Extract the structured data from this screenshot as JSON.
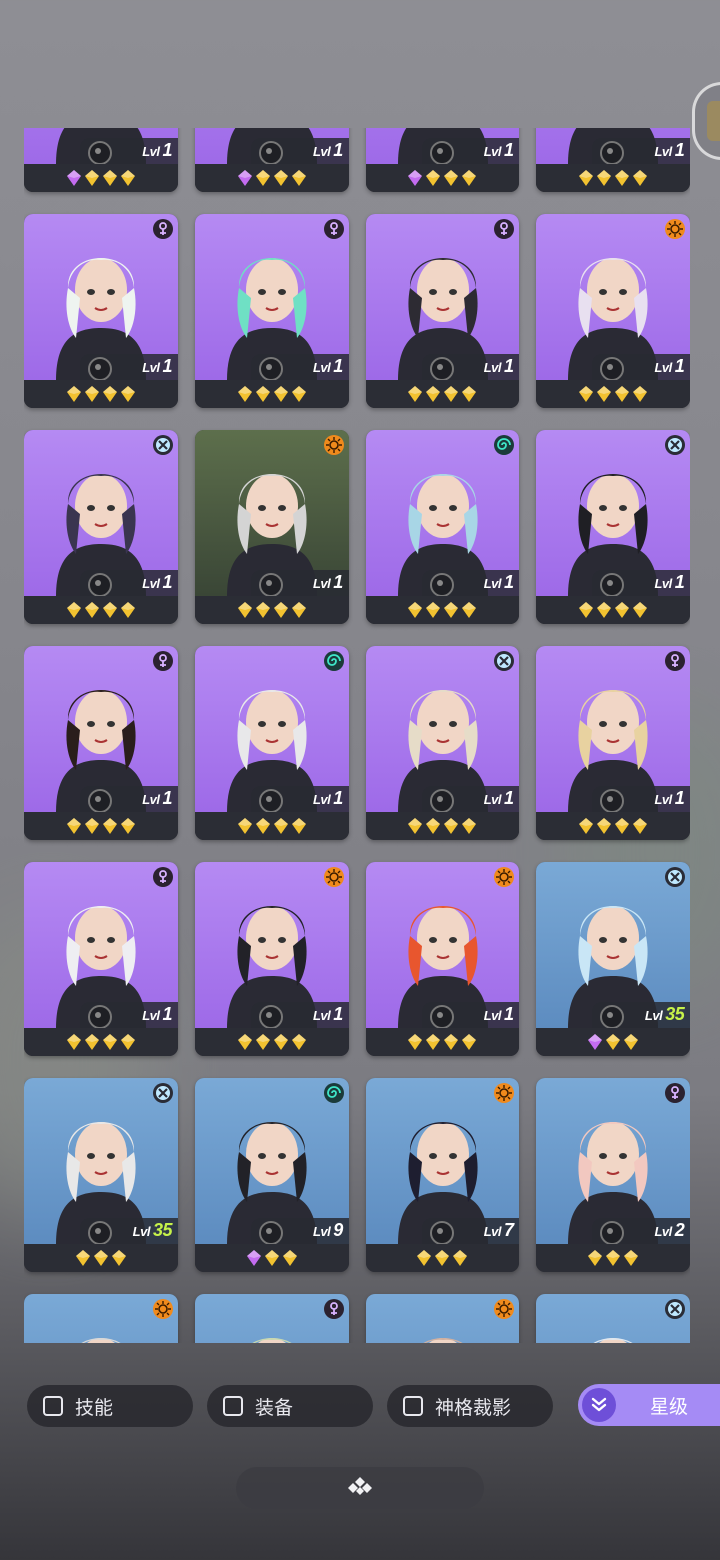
{
  "rows": [
    [
      {
        "level": "1",
        "gems": [
          "purple",
          "gold",
          "gold",
          "gold"
        ],
        "bg": "purple",
        "badge": "none",
        "hair": "#a8e8c6"
      },
      {
        "level": "1",
        "gems": [
          "purple",
          "gold",
          "gold",
          "gold"
        ],
        "bg": "purple",
        "badge": "none",
        "hair": "#6a6a6a"
      },
      {
        "level": "1",
        "gems": [
          "purple",
          "gold",
          "gold",
          "gold"
        ],
        "bg": "purple",
        "badge": "none",
        "hair": "#e0e0e0"
      },
      {
        "level": "1",
        "gems": [
          "gold",
          "gold",
          "gold",
          "gold"
        ],
        "bg": "purple",
        "badge": "none",
        "hair": "#a0a8b0"
      }
    ],
    [
      {
        "level": "1",
        "gems": [
          "gold",
          "gold",
          "gold",
          "gold"
        ],
        "bg": "purple",
        "badge": "psi",
        "hair": "#eef4f0"
      },
      {
        "level": "1",
        "gems": [
          "gold",
          "gold",
          "gold",
          "gold"
        ],
        "bg": "purple",
        "badge": "psi",
        "hair": "#6fe0c4"
      },
      {
        "level": "1",
        "gems": [
          "gold",
          "gold",
          "gold",
          "gold"
        ],
        "bg": "purple",
        "badge": "psi",
        "hair": "#2d2b33"
      },
      {
        "level": "1",
        "gems": [
          "gold",
          "gold",
          "gold",
          "gold"
        ],
        "bg": "purple",
        "badge": "sun",
        "hair": "#e8e0f0"
      }
    ],
    [
      {
        "level": "1",
        "gems": [
          "gold",
          "gold",
          "gold",
          "gold"
        ],
        "bg": "purple",
        "badge": "cross",
        "hair": "#3a3550"
      },
      {
        "level": "1",
        "gems": [
          "gold",
          "gold",
          "gold",
          "gold"
        ],
        "bg": "dark",
        "badge": "sun",
        "hair": "#d4d4d4"
      },
      {
        "level": "1",
        "gems": [
          "gold",
          "gold",
          "gold",
          "gold"
        ],
        "bg": "purple",
        "badge": "spiral",
        "hair": "#a8d6e6"
      },
      {
        "level": "1",
        "gems": [
          "gold",
          "gold",
          "gold",
          "gold"
        ],
        "bg": "purple",
        "badge": "cross",
        "hair": "#1f1f24"
      }
    ],
    [
      {
        "level": "1",
        "gems": [
          "gold",
          "gold",
          "gold",
          "gold"
        ],
        "bg": "purple",
        "badge": "psi",
        "hair": "#2a1e1c"
      },
      {
        "level": "1",
        "gems": [
          "gold",
          "gold",
          "gold",
          "gold"
        ],
        "bg": "purple",
        "badge": "spiral",
        "hair": "#e8e8ea"
      },
      {
        "level": "1",
        "gems": [
          "gold",
          "gold",
          "gold",
          "gold"
        ],
        "bg": "purple",
        "badge": "cross",
        "hair": "#e6dcc8"
      },
      {
        "level": "1",
        "gems": [
          "gold",
          "gold",
          "gold",
          "gold"
        ],
        "bg": "purple",
        "badge": "psi",
        "hair": "#e8d2a0"
      }
    ],
    [
      {
        "level": "1",
        "gems": [
          "gold",
          "gold",
          "gold",
          "gold"
        ],
        "bg": "purple",
        "badge": "psi",
        "hair": "#eeeef2"
      },
      {
        "level": "1",
        "gems": [
          "gold",
          "gold",
          "gold",
          "gold"
        ],
        "bg": "purple",
        "badge": "sun",
        "hair": "#222228"
      },
      {
        "level": "1",
        "gems": [
          "gold",
          "gold",
          "gold",
          "gold"
        ],
        "bg": "purple",
        "badge": "sun",
        "hair": "#e8562e"
      },
      {
        "level": "35",
        "gems": [
          "purple",
          "gold",
          "gold"
        ],
        "bg": "blue",
        "badge": "cross",
        "hair": "#c9e6f6"
      }
    ],
    [
      {
        "level": "35",
        "gems": [
          "gold",
          "gold",
          "gold"
        ],
        "bg": "blue",
        "badge": "cross",
        "hair": "#e8e8e8"
      },
      {
        "level": "9",
        "gems": [
          "purple",
          "gold",
          "gold"
        ],
        "bg": "blue",
        "badge": "spiral",
        "hair": "#222228"
      },
      {
        "level": "7",
        "gems": [
          "gold",
          "gold",
          "gold"
        ],
        "bg": "blue",
        "badge": "sun",
        "hair": "#1e1e30"
      },
      {
        "level": "2",
        "gems": [
          "gold",
          "gold",
          "gold"
        ],
        "bg": "blue",
        "badge": "psi",
        "hair": "#f2c8c0"
      }
    ],
    [
      {
        "level": "",
        "gems": [],
        "bg": "blue",
        "badge": "sun",
        "hair": "#d8d8d8"
      },
      {
        "level": "",
        "gems": [],
        "bg": "blue",
        "badge": "psi",
        "hair": "#c8d8b0"
      },
      {
        "level": "",
        "gems": [],
        "bg": "blue",
        "badge": "sun",
        "hair": "#d0b0a0"
      },
      {
        "level": "",
        "gems": [],
        "bg": "blue",
        "badge": "cross",
        "hair": "#e0e8f0"
      }
    ]
  ],
  "level_prefix": "Lvl",
  "filters": {
    "skill": "技能",
    "equipment": "装备",
    "divinity_shadow": "神格裁影",
    "star_rank": "星级"
  },
  "colors": {
    "gem_gold": "#f2c230",
    "gem_purple": "#c46cf0",
    "level_high": "#c6f24a",
    "accent": "#a58bf5"
  }
}
